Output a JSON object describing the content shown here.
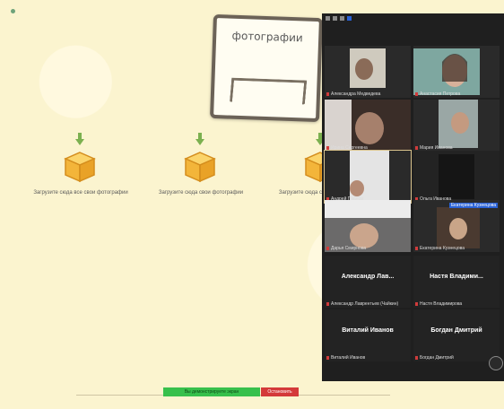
{
  "board": {
    "card_title": "фотографии",
    "nodes": [
      {
        "caption": "Загрузите сюда все свои фотографии"
      },
      {
        "caption": "Загрузите сюда свои фотографии"
      },
      {
        "caption": "Загрузите сюда свои фотографии"
      }
    ],
    "colors": {
      "background": "#fbf4cf",
      "arrow": "#7bb04f",
      "box": "#f3b53a"
    }
  },
  "zoom": {
    "participants": [
      {
        "name": "Александра Медведева",
        "has_video": true
      },
      {
        "name": "Анастасия Петрова",
        "has_video": true
      },
      {
        "name": "Ирина Сергеевна",
        "has_video": true
      },
      {
        "name": "Мария Иванова",
        "has_video": true
      },
      {
        "name": "Андрей Павлов",
        "has_video": true,
        "highlight": true
      },
      {
        "name": "Ольга Иванова",
        "has_video": false
      },
      {
        "name": "Дарья Смирнова",
        "has_video": true
      },
      {
        "name": "Екатерина Кузнецова",
        "has_video": true,
        "speaker_tag": "Екатерина Кузнецова"
      },
      {
        "name": "Александр Лаврентьев (Чайкин)",
        "display": "Александр Лав...",
        "has_video": false
      },
      {
        "name": "Настя Владимирова",
        "display": "Настя Владими...",
        "has_video": false
      },
      {
        "name": "Виталий Иванов",
        "display": "Виталий Иванов",
        "has_video": false
      },
      {
        "name": "Богдан Дмитрий",
        "display": "Богдан Дмитрий",
        "has_video": false
      }
    ]
  },
  "meeting_bar": {
    "share_label": "Вы демонстрируете экран",
    "stop_label": "Остановить"
  }
}
